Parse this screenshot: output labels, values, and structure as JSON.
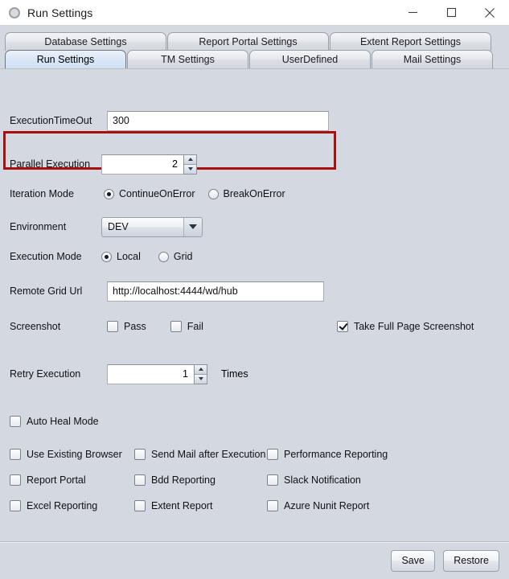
{
  "window": {
    "title": "Run Settings",
    "icon": "app-circle-icon",
    "controls": {
      "minimize": "minimize-icon",
      "maximize": "maximize-icon",
      "close": "close-icon"
    }
  },
  "tabs": {
    "row1": [
      {
        "label": "Database Settings",
        "selected": false
      },
      {
        "label": "Report Portal Settings",
        "selected": false
      },
      {
        "label": "Extent Report Settings",
        "selected": false
      }
    ],
    "row2": [
      {
        "label": "Run Settings",
        "selected": true
      },
      {
        "label": "TM Settings",
        "selected": false
      },
      {
        "label": "UserDefined",
        "selected": false
      },
      {
        "label": "Mail Settings",
        "selected": false
      }
    ]
  },
  "form": {
    "execution_timeout": {
      "label": "ExecutionTimeOut",
      "value": "300",
      "highlighted": true
    },
    "parallel_execution": {
      "label": "Parallel Execution",
      "value": "2"
    },
    "iteration_mode": {
      "label": "Iteration Mode",
      "options": [
        {
          "label": "ContinueOnError",
          "selected": true
        },
        {
          "label": "BreakOnError",
          "selected": false
        }
      ]
    },
    "environment": {
      "label": "Environment",
      "value": "DEV"
    },
    "execution_mode": {
      "label": "Execution Mode",
      "options": [
        {
          "label": "Local",
          "selected": true
        },
        {
          "label": "Grid",
          "selected": false
        }
      ]
    },
    "remote_grid_url": {
      "label": "Remote Grid Url",
      "value": "http://localhost:4444/wd/hub"
    },
    "screenshot": {
      "label": "Screenshot",
      "pass": {
        "label": "Pass",
        "checked": false
      },
      "fail": {
        "label": "Fail",
        "checked": false
      },
      "full_page": {
        "label": "Take Full Page Screenshot",
        "checked": true
      }
    },
    "retry_execution": {
      "label": "Retry Execution",
      "value": "1",
      "suffix": "Times"
    },
    "auto_heal_mode": {
      "label": "Auto Heal Mode",
      "checked": false
    },
    "options_grid": [
      {
        "label": "Use Existing Browser",
        "checked": false
      },
      {
        "label": "Send Mail after Execution",
        "checked": false
      },
      {
        "label": "Performance Reporting",
        "checked": false
      },
      {
        "label": "Report Portal",
        "checked": false
      },
      {
        "label": "Bdd Reporting",
        "checked": false
      },
      {
        "label": "Slack Notification",
        "checked": false
      },
      {
        "label": "Excel Reporting",
        "checked": false
      },
      {
        "label": "Extent Report",
        "checked": false
      },
      {
        "label": "Azure Nunit Report",
        "checked": false
      }
    ]
  },
  "footer": {
    "save": "Save",
    "restore": "Restore"
  },
  "colors": {
    "highlight": "#a90f0f",
    "panel": "#d4d8e0",
    "selected_tab": "#d9e6f6"
  }
}
